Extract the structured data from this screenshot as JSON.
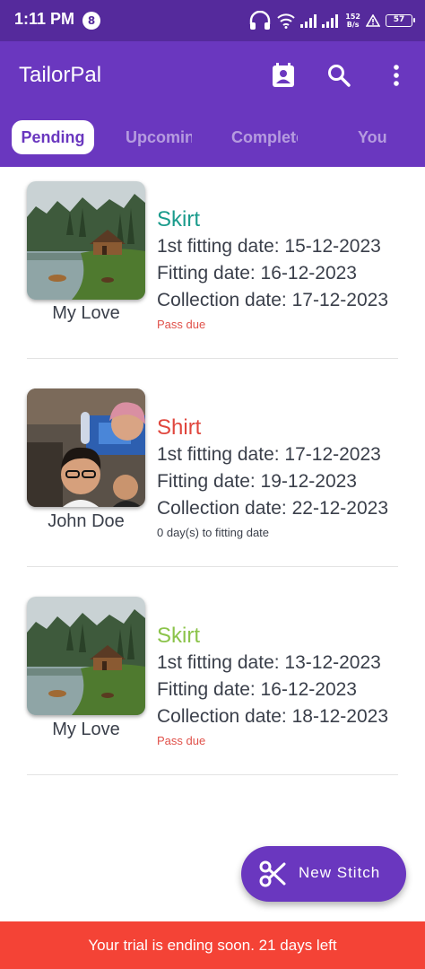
{
  "status_bar": {
    "time": "1:11 PM",
    "badge": "8",
    "speed_value": "152",
    "speed_unit": "B/s",
    "battery": "57"
  },
  "app_bar": {
    "title": "TailorPal",
    "icons": [
      "contacts-icon",
      "search-icon",
      "more-vert-icon"
    ]
  },
  "tabs": [
    {
      "label": "Pending",
      "active": true
    },
    {
      "label": "Upcoming",
      "active": false
    },
    {
      "label": "Completed",
      "active": false
    },
    {
      "label": "You",
      "active": false
    }
  ],
  "orders": [
    {
      "owner": "My Love",
      "garment": "Skirt",
      "garment_color": "#1a9b8c",
      "first_fitting": "1st fitting date: 15-12-2023",
      "fitting": "Fitting date: 16-12-2023",
      "collection": "Collection date: 17-12-2023",
      "note": "Pass due",
      "note_color": "#e0514a",
      "photo": "lake-cabin-photo"
    },
    {
      "owner": "John Doe",
      "garment": "Shirt",
      "garment_color": "#e0463d",
      "first_fitting": "1st fitting date: 17-12-2023",
      "fitting": "Fitting date: 19-12-2023",
      "collection": "Collection date: 22-12-2023",
      "note": "0 day(s) to fitting date",
      "note_color": "#3a3f4a",
      "photo": "selfie-photo"
    },
    {
      "owner": "My Love",
      "garment": "Skirt",
      "garment_color": "#8bc34a",
      "first_fitting": "1st fitting date: 13-12-2023",
      "fitting": "Fitting date: 16-12-2023",
      "collection": "Collection date: 18-12-2023",
      "note": "Pass due",
      "note_color": "#e0514a",
      "photo": "lake-cabin-photo"
    }
  ],
  "fab": {
    "label": "New Stitch",
    "icon": "scissors-icon"
  },
  "banner": {
    "text": "Your trial is ending soon. 21 days left"
  },
  "colors": {
    "primary": "#6a37bf",
    "status_bar": "#552a9c",
    "banner": "#f44336"
  }
}
